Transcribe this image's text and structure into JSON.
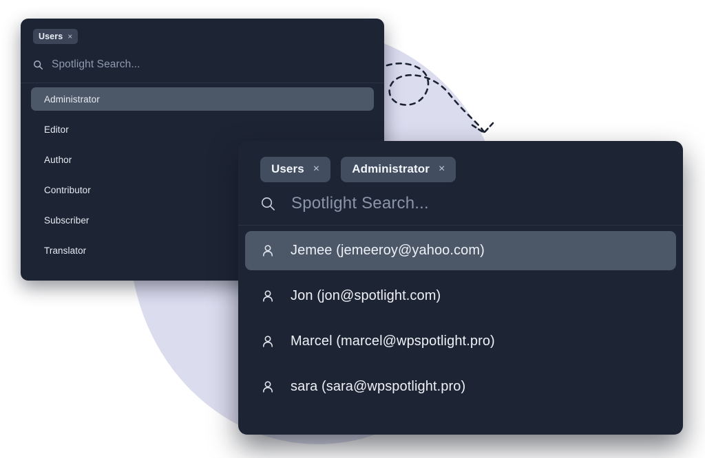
{
  "theme": {
    "page_background": "#ffffff",
    "panel_background": "#1d2433",
    "blob_color": "#dcdcef",
    "highlight_row": "#4c5768",
    "tag_background": "#424d60",
    "text_primary": "#eef1f7",
    "text_muted": "#8a95a9",
    "arrow_color": "#1b2333"
  },
  "decorations": {
    "blob_name": "lavender-circle",
    "arrow_name": "curved-dashed-arrow"
  },
  "back_panel": {
    "tags": [
      {
        "label": "Users",
        "close": "×"
      }
    ],
    "search": {
      "icon": "search-icon",
      "placeholder": "Spotlight Search..."
    },
    "roles": [
      {
        "label": "Administrator",
        "selected": true
      },
      {
        "label": "Editor",
        "selected": false
      },
      {
        "label": "Author",
        "selected": false
      },
      {
        "label": "Contributor",
        "selected": false
      },
      {
        "label": "Subscriber",
        "selected": false
      },
      {
        "label": "Translator",
        "selected": false
      }
    ]
  },
  "front_panel": {
    "tags": [
      {
        "label": "Users",
        "close": "×"
      },
      {
        "label": "Administrator",
        "close": "×"
      }
    ],
    "search": {
      "icon": "search-icon",
      "placeholder": "Spotlight Search..."
    },
    "results": [
      {
        "icon": "user-icon",
        "label": "Jemee (jemeeroy@yahoo.com)",
        "selected": true
      },
      {
        "icon": "user-icon",
        "label": "Jon (jon@spotlight.com)",
        "selected": false
      },
      {
        "icon": "user-icon",
        "label": "Marcel (marcel@wpspotlight.pro)",
        "selected": false
      },
      {
        "icon": "user-icon",
        "label": "sara (sara@wpspotlight.pro)",
        "selected": false
      }
    ]
  }
}
